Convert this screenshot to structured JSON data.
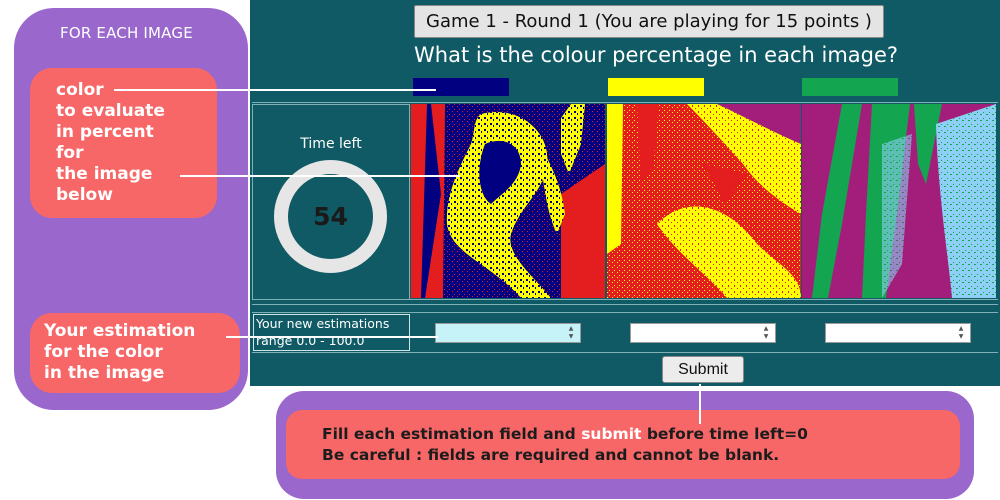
{
  "left_panel": {
    "title": "FOR EACH IMAGE",
    "color_note": {
      "line1_highlight": "color",
      "line2": "to evaluate",
      "line3": "in percent",
      "line4": "for",
      "line5_prefix": "the ",
      "line5_highlight": "image",
      "line6": "below"
    },
    "estimation_note": {
      "line1_prefix": "Your ",
      "line1_highlight": "estimation",
      "line2": "for the color",
      "line3": "in the image"
    }
  },
  "game": {
    "round_title": "Game 1 - Round 1 (You are playing for 15 points )",
    "question": "What is the colour percentage in each image?",
    "target_colors": [
      "#000080",
      "#ffff00",
      "#13a550"
    ],
    "time_left_label": "Time left",
    "time_left_value": "54",
    "estimations_label_line1": "Your new estimations",
    "estimations_label_line2": "range 0.0 - 100.0",
    "inputs": [
      {
        "value": "",
        "placeholder": ""
      },
      {
        "value": "",
        "placeholder": ""
      },
      {
        "value": "",
        "placeholder": ""
      }
    ],
    "submit_label": "Submit",
    "spin_up": "▲",
    "spin_down": "▼"
  },
  "bottom_panel": {
    "line1_prefix": "Fill each estimation field and ",
    "line1_highlight": "submit",
    "line1_suffix": " before time left=0",
    "line2": "Be careful : fields are required and cannot be blank."
  },
  "colors": {
    "game_bg": "#0f5a64",
    "help_panel": "#9a67cd",
    "note_box": "#f86767",
    "image1_colors": [
      "#000080",
      "#ffff00",
      "#e41e1e"
    ],
    "image2_colors": [
      "#ffff00",
      "#e41e1e",
      "#a31e7a"
    ],
    "image3_colors": [
      "#13a550",
      "#a31e7a",
      "#8ecff5"
    ]
  }
}
